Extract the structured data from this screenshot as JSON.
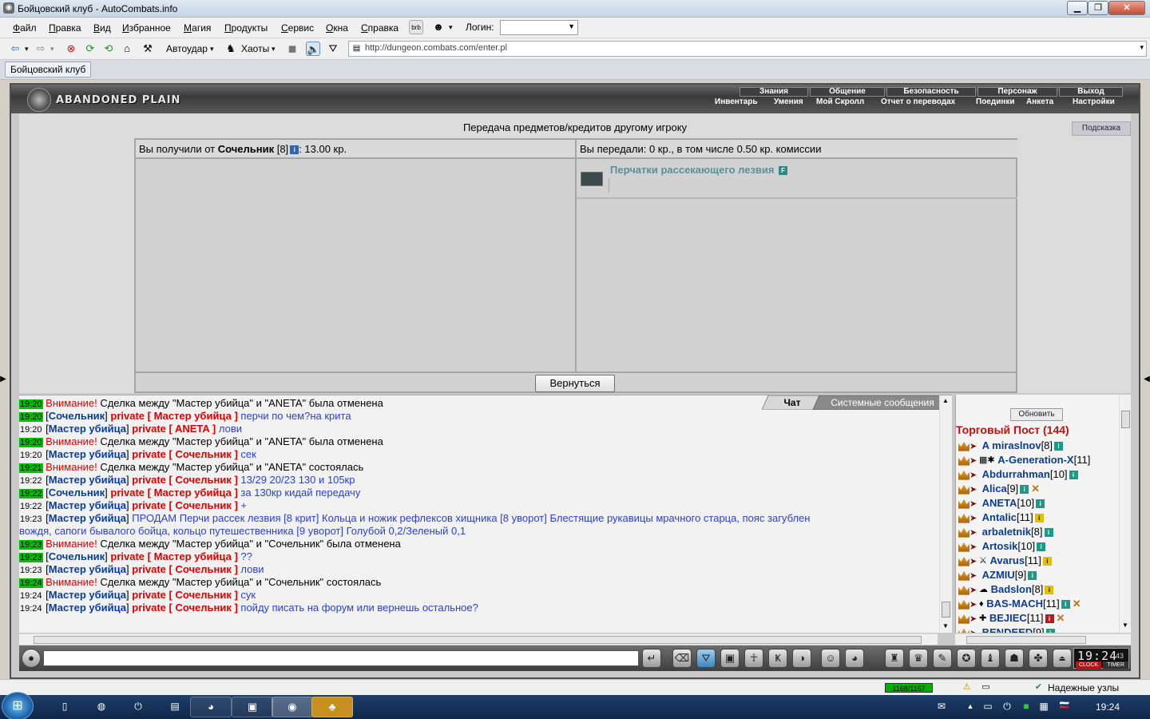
{
  "window": {
    "title": "Бойцовский клуб - AutoCombats.info"
  },
  "menu": {
    "items": [
      "Файл",
      "Правка",
      "Вид",
      "Избранное",
      "Магия",
      "Продукты",
      "Сервис",
      "Окна",
      "Справка"
    ],
    "login_label": "Логин:"
  },
  "toolbar": {
    "autoudar": "Автоудар",
    "haoty": "Хаоты",
    "url": "http://dungeon.combats.com/enter.pl"
  },
  "tabs": {
    "active": "Бойцовский клуб"
  },
  "game": {
    "logo": "ABANDONED PLAIN",
    "nav_top": [
      "Знания",
      "Общение",
      "Безопасность",
      "Персонаж",
      "Выход"
    ],
    "nav_bottom": [
      "Инвентарь",
      "Умения",
      "Мой Скролл",
      "Отчет о переводах",
      "Поединки",
      "Анкета",
      "Настройки"
    ]
  },
  "trade": {
    "title": "Передача предметов/кредитов другому игроку",
    "hint": "Подсказка",
    "received_prefix": "Вы получили от ",
    "received_from": "Сочельник",
    "received_level": "[8]",
    "received_amount": ": 13.00 кр.",
    "sent": "Вы передали: 0 кр., в том числе 0.50 кр. комиссии",
    "item_name": "Перчатки рассекающего лезвия",
    "back_button": "Вернуться"
  },
  "chat": {
    "tab_chat": "Чат",
    "tab_system": "Системные сообщения",
    "lines": [
      {
        "time": "19:20",
        "hl": true,
        "type": "sys",
        "warn": "Внимание!",
        "text": " Сделка между \"Мастер убийца\" и \"ANETA\" была отменена"
      },
      {
        "time": "19:20",
        "hl": true,
        "type": "priv",
        "from": "Сочельник",
        "to": "Мастер убийца",
        "text": "перчи по чем?на крита"
      },
      {
        "time": "19:20",
        "hl": false,
        "type": "priv",
        "from": "Мастер убийца",
        "to": "ANETA",
        "text": "лови"
      },
      {
        "time": "19:20",
        "hl": true,
        "type": "sys",
        "warn": "Внимание!",
        "text": " Сделка между \"Мастер убийца\" и \"ANETA\" была отменена"
      },
      {
        "time": "19:20",
        "hl": false,
        "type": "priv",
        "from": "Мастер убийца",
        "to": "Сочельник",
        "text": "сек"
      },
      {
        "time": "19:21",
        "hl": true,
        "type": "sys",
        "warn": "Внимание!",
        "text": " Сделка между \"Мастер убийца\" и \"ANETA\" состоялась"
      },
      {
        "time": "19:22",
        "hl": false,
        "type": "priv",
        "from": "Мастер убийца",
        "to": "Сочельник",
        "text": "13/29 20/23 130 и 105кр"
      },
      {
        "time": "19:22",
        "hl": true,
        "type": "priv",
        "from": "Сочельник",
        "to": "Мастер убийца",
        "text": "за 130кр кидай передачу"
      },
      {
        "time": "19:22",
        "hl": false,
        "type": "priv",
        "from": "Мастер убийца",
        "to": "Сочельник",
        "text": "+"
      },
      {
        "time": "19:23",
        "hl": false,
        "type": "pub",
        "from": "Мастер убийца",
        "text": "ПРОДАМ Перчи рассек лезвия [8 крит] Кольца и ножик рефлексов хищника [8 уворот] Блестящие рукавицы мрачного старца, пояс загублен",
        "cont": "вождя, сапоги бывалого бойца, кольцо путешественника [9 уворот] Голубой 0,2/Зеленый 0,1"
      },
      {
        "time": "19:23",
        "hl": true,
        "type": "sys",
        "warn": "Внимание!",
        "text": " Сделка между \"Мастер убийца\" и \"Сочельник\" была отменена"
      },
      {
        "time": "19:23",
        "hl": true,
        "type": "priv",
        "from": "Сочельник",
        "to": "Мастер убийца",
        "text": "??"
      },
      {
        "time": "19:23",
        "hl": false,
        "type": "priv",
        "from": "Мастер убийца",
        "to": "Сочельник",
        "text": "лови"
      },
      {
        "time": "19:24",
        "hl": true,
        "type": "sys",
        "warn": "Внимание!",
        "text": " Сделка между \"Мастер убийца\" и \"Сочельник\" состоялась"
      },
      {
        "time": "19:24",
        "hl": false,
        "type": "priv",
        "from": "Мастер убийца",
        "to": "Сочельник",
        "text": "сук"
      },
      {
        "time": "19:24",
        "hl": false,
        "type": "priv",
        "from": "Мастер убийца",
        "to": "Сочельник",
        "text": "пойду писать на форум или вернешь остальное?"
      }
    ]
  },
  "users": {
    "refresh": "Обновить",
    "room": "Торговый Пост (144)",
    "list": [
      {
        "name": "A miraslnov",
        "lvl": "[8]",
        "pre": "",
        "post": "i"
      },
      {
        "name": "A-Generation-X",
        "lvl": "[11]",
        "pre": "▦✱",
        "post": ""
      },
      {
        "name": "Abdurrahman",
        "lvl": "[10]",
        "pre": "",
        "post": "i"
      },
      {
        "name": "Alica",
        "lvl": "[9]",
        "pre": "",
        "post": "ix"
      },
      {
        "name": "ANETA",
        "lvl": "[10]",
        "pre": "",
        "post": "i"
      },
      {
        "name": "Antalic",
        "lvl": "[11]",
        "pre": "",
        "post": "y"
      },
      {
        "name": "arbaletnik",
        "lvl": "[8]",
        "pre": "",
        "post": "i"
      },
      {
        "name": "Artosik",
        "lvl": "[10]",
        "pre": "",
        "post": "i"
      },
      {
        "name": "Avarus",
        "lvl": "[11]",
        "pre": "⚔",
        "post": "y"
      },
      {
        "name": "AZMIU",
        "lvl": "[9]",
        "pre": "",
        "post": "i"
      },
      {
        "name": "Badslon",
        "lvl": "[8]",
        "pre": "☁",
        "post": "y"
      },
      {
        "name": "BAS-MACH",
        "lvl": "[11]",
        "pre": "♦",
        "post": "ix"
      },
      {
        "name": "BEJIEC",
        "lvl": "[11]",
        "pre": "✚",
        "post": "rx"
      },
      {
        "name": "BENDEED",
        "lvl": "[9]",
        "pre": "",
        "post": "i"
      }
    ]
  },
  "clock": {
    "time": "19:24",
    "sec": "43",
    "clock_label": "CLOCK",
    "timer_label": "TIMER"
  },
  "status": {
    "counter": "1168/1167",
    "nodes": "Надежные узлы"
  },
  "tray": {
    "time": "19:24"
  }
}
